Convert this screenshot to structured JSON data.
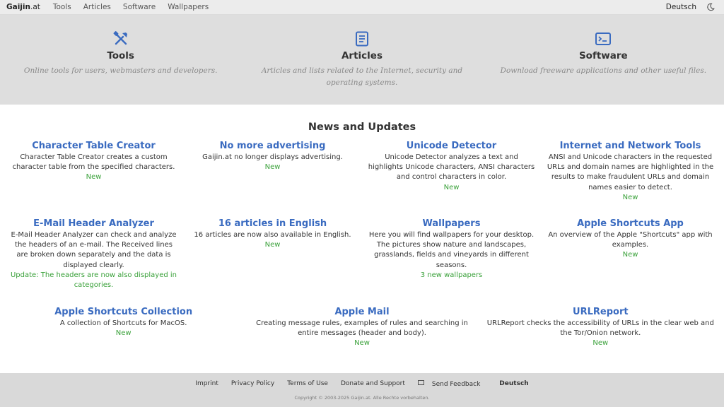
{
  "nav": {
    "brand_main": "Gaijin",
    "brand_tld": ".at",
    "links": [
      "Tools",
      "Articles",
      "Software",
      "Wallpapers"
    ],
    "language": "Deutsch",
    "theme_icon": "moon-icon"
  },
  "hero": [
    {
      "icon": "tools-icon",
      "title": "Tools",
      "text": "Online tools for users, webmasters and developers."
    },
    {
      "icon": "article-icon",
      "title": "Articles",
      "text": "Articles and lists related to the Internet, security and operating systems."
    },
    {
      "icon": "terminal-icon",
      "title": "Software",
      "text": "Download freeware applications and other useful files."
    }
  ],
  "news": {
    "title": "News and Updates",
    "items": [
      {
        "title": "Character Table Creator",
        "desc": "Character Table Creator creates a custom character table from the specified characters.",
        "status": "New"
      },
      {
        "title": "No more advertising",
        "desc": "Gaijin.at no longer displays advertising.",
        "status": "New"
      },
      {
        "title": "Unicode Detector",
        "desc": "Unicode Detector analyzes a text and highlights Unicode characters, ANSI characters and control characters in color.",
        "status": "New"
      },
      {
        "title": "Internet and Network Tools",
        "desc": "ANSI and Unicode characters in the requested URLs and domain names are highlighted in the results to make fraudulent URLs and domain names easier to detect.",
        "status": "New"
      },
      {
        "title": "E-Mail Header Analyzer",
        "desc": "E-Mail Header Analyzer can check and analyze the headers of an e-mail. The Received lines are broken down separately and the data is displayed clearly.",
        "status": "Update: The headers are now also displayed in categories."
      },
      {
        "title": "16 articles in English",
        "desc": "16 articles are now also available in English.",
        "status": "New"
      },
      {
        "title": "Wallpapers",
        "desc": "Here you will find wallpapers for your desktop. The pictures show nature and landscapes, grasslands, fields and vineyards in different seasons.",
        "status": "3 new wallpapers"
      },
      {
        "title": "Apple Shortcuts App",
        "desc": "An overview of the Apple \"Shortcuts\" app with examples.",
        "status": "New"
      },
      {
        "title": "Apple Shortcuts Collection",
        "desc": "A collection of Shortcuts for MacOS.",
        "status": "New"
      },
      {
        "title": "Apple Mail",
        "desc": "Creating message rules, examples of rules and searching in entire messages (header and body).",
        "status": "New"
      },
      {
        "title": "URLReport",
        "desc": "URLReport checks the accessibility of URLs in the clear web and the Tor/Onion network.",
        "status": "New"
      }
    ]
  },
  "footer": {
    "links": [
      "Imprint",
      "Privacy Policy",
      "Terms of Use",
      "Donate and Support",
      "Send Feedback",
      "Deutsch"
    ],
    "copyright": "Copyright © 2003-2025 Gaijin.at. Alle Rechte vorbehalten."
  },
  "colors": {
    "accent": "#3a6bc0",
    "status": "#3aa13a",
    "hero_bg": "#dedede",
    "footer_bg": "#d9d9d9"
  }
}
